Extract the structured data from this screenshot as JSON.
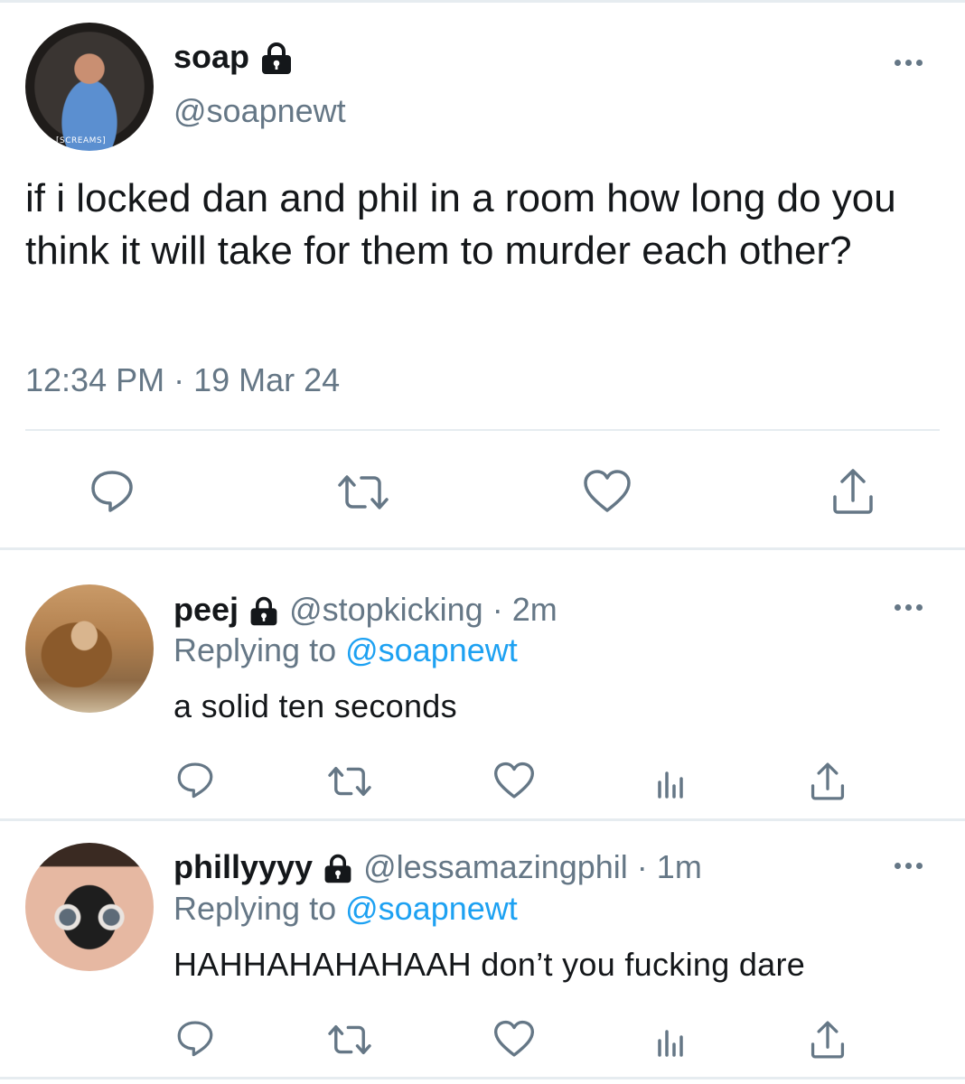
{
  "main_tweet": {
    "author": {
      "display_name": "soap",
      "handle": "@soapnewt",
      "avatar_caption": "[SCREAMS]"
    },
    "text": "if i locked dan and phil in a room how long do you think it will take for them to murder each other?",
    "timestamp": "12:34 PM · 19 Mar 24",
    "actions": [
      "reply-icon",
      "retweet-icon",
      "like-icon",
      "share-icon"
    ]
  },
  "replies": [
    {
      "display_name": "peej",
      "handle": "@stopkicking",
      "time_sep": " · ",
      "time": "2m",
      "replying_prefix": "Replying to ",
      "replying_to": "@soapnewt",
      "text": "a solid ten seconds",
      "actions": [
        "reply-icon",
        "retweet-icon",
        "like-icon",
        "analytics-icon",
        "share-icon"
      ]
    },
    {
      "display_name": "phillyyyy",
      "handle": "@lessamazingphil",
      "time_sep": " · ",
      "time": "1m",
      "replying_prefix": "Replying to ",
      "replying_to": "@soapnewt",
      "text": "HAHHAHAHAHAAH don’t you fucking dare",
      "actions": [
        "reply-icon",
        "retweet-icon",
        "like-icon",
        "analytics-icon",
        "share-icon"
      ]
    }
  ],
  "colors": {
    "text": "#14171a",
    "muted": "#657786",
    "link": "#1da1f2",
    "divider": "#e6ecf0"
  }
}
